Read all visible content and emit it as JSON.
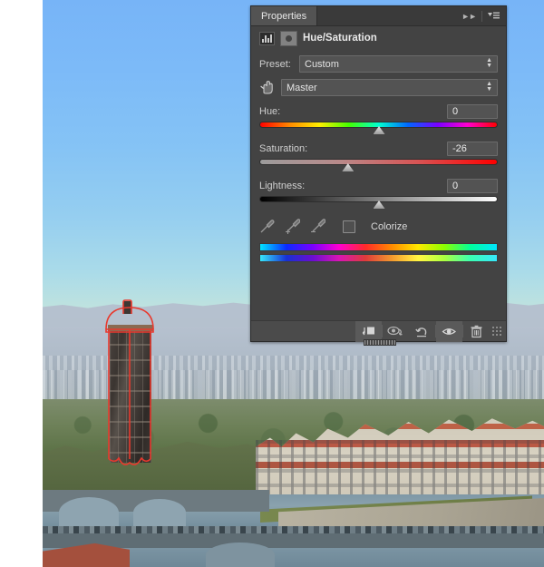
{
  "panel": {
    "tab_label": "Properties",
    "collapse_icon": "double-chevron-right-icon",
    "menu_icon": "panel-menu-icon",
    "title": "Hue/Saturation",
    "adjustment_icon": "hue-saturation-adjustment-icon",
    "mask_icon": "layer-mask-thumbnail-icon"
  },
  "controls": {
    "preset_label": "Preset:",
    "preset_value": "Custom",
    "target_tool_icon": "targeted-adjustment-hand-icon",
    "channel_value": "Master",
    "hue_label": "Hue:",
    "hue_value": "0",
    "saturation_label": "Saturation:",
    "saturation_value": "-26",
    "lightness_label": "Lightness:",
    "lightness_value": "0",
    "colorize_label": "Colorize",
    "colorize_checked": false,
    "eyedropper_icon": "eyedropper-icon",
    "eyedropper_add_icon": "eyedropper-add-icon",
    "eyedropper_subtract_icon": "eyedropper-subtract-icon"
  },
  "slider_positions": {
    "hue_percent": 50,
    "saturation_percent": 37,
    "lightness_percent": 50
  },
  "colorbars": {
    "top_label": "source-color-range-bar",
    "bottom_label": "result-color-range-bar"
  },
  "footer": {
    "clip_to_layer_icon": "clip-to-layer-icon",
    "view_previous_icon": "view-previous-state-icon",
    "reset_icon": "reset-adjustment-icon",
    "visibility_icon": "toggle-layer-visibility-icon",
    "delete_icon": "delete-adjustment-layer-icon",
    "grip_icon": "panel-resize-grip-icon"
  },
  "canvas": {
    "image_description": "florence-cityscape-photo",
    "selection_path_label": "tower-selection-path",
    "selection_color": "#e8392e"
  }
}
